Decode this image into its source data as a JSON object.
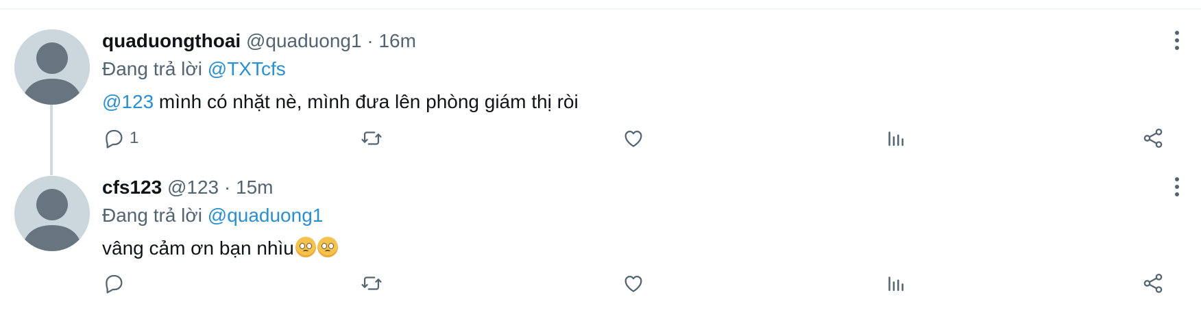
{
  "colors": {
    "text": "#0f1419",
    "muted": "#536471",
    "link": "#2a8fd1",
    "divider": "#eff3f4",
    "avatar_bg": "#ccd6dd"
  },
  "tweets": [
    {
      "display_name": "quaduongthoai",
      "handle": "@quaduong1",
      "separator": "·",
      "time": "16m",
      "reply_prefix": "Đang trả lời",
      "reply_to": "@TXTcfs",
      "text_mention": "@123",
      "text": " mình có nhặt nè, mình đưa lên phòng giám thị ròi",
      "reply_count": "1"
    },
    {
      "display_name": "cfs123",
      "handle": "@123",
      "separator": "·",
      "time": "15m",
      "reply_prefix": "Đang trả lời",
      "reply_to": "@quaduong1",
      "text": "vâng cảm ơn bạn nhìu",
      "emojis": [
        "pleading-face-emoji",
        "pleading-face-emoji"
      ],
      "reply_count": ""
    }
  ],
  "icons": {
    "reply": "speech-bubble-icon",
    "retweet": "retweet-arrows-icon",
    "like": "heart-icon",
    "views": "bar-chart-icon",
    "share": "share-icon",
    "more": "vertical-ellipsis-icon"
  }
}
